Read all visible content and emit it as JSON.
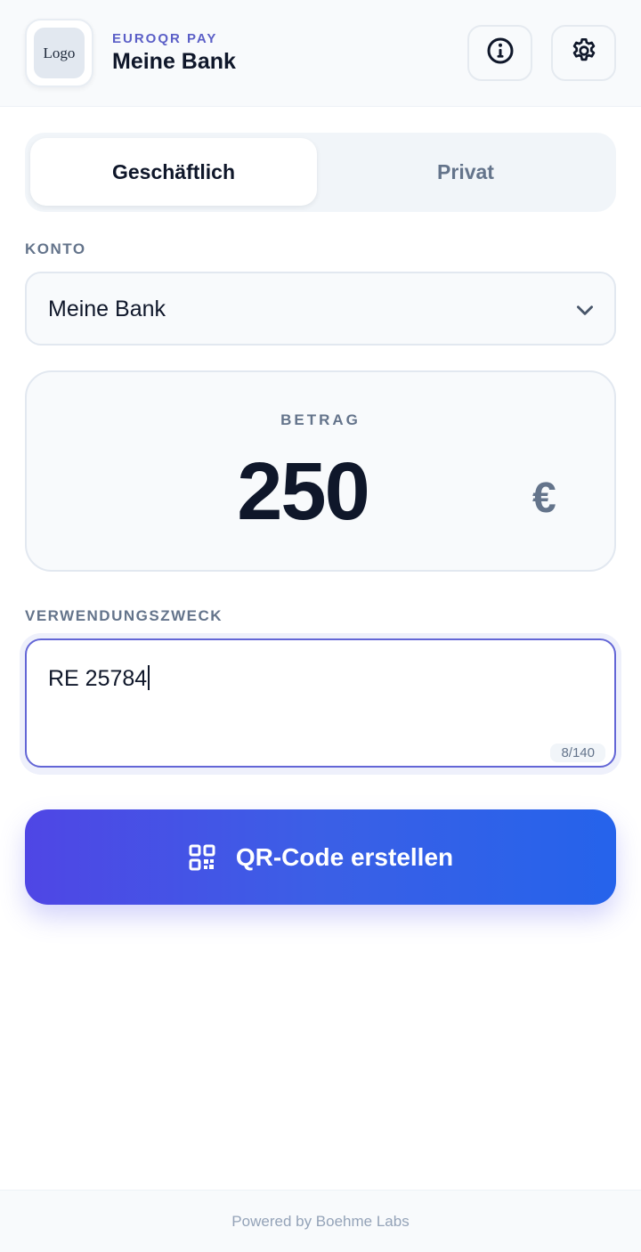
{
  "header": {
    "logo_text": "Logo",
    "brand_subtitle": "EUROQR PAY",
    "brand_title": "Meine Bank",
    "info_icon": "info-icon",
    "settings_icon": "gear-icon"
  },
  "mode_tabs": [
    {
      "label": "Geschäftlich",
      "active": true
    },
    {
      "label": "Privat",
      "active": false
    }
  ],
  "account": {
    "label": "KONTO",
    "selected": "Meine Bank",
    "icon": "chevron-down-icon"
  },
  "amount": {
    "label": "BETRAG",
    "value": "250",
    "currency": "€"
  },
  "purpose": {
    "label": "VERWENDUNGSZWECK",
    "value": "RE 25784",
    "counter": "8/140"
  },
  "primary_action": {
    "label": "QR-Code erstellen",
    "icon": "qr-code-icon"
  },
  "footer": {
    "text": "Powered by Boehme Labs"
  },
  "colors": {
    "accent": "#5b5fc7",
    "focus_border": "#6366d6",
    "button_gradient_start": "#4f46e5",
    "button_gradient_end": "#2563eb",
    "text_primary": "#0f172a",
    "text_muted": "#64748b"
  }
}
